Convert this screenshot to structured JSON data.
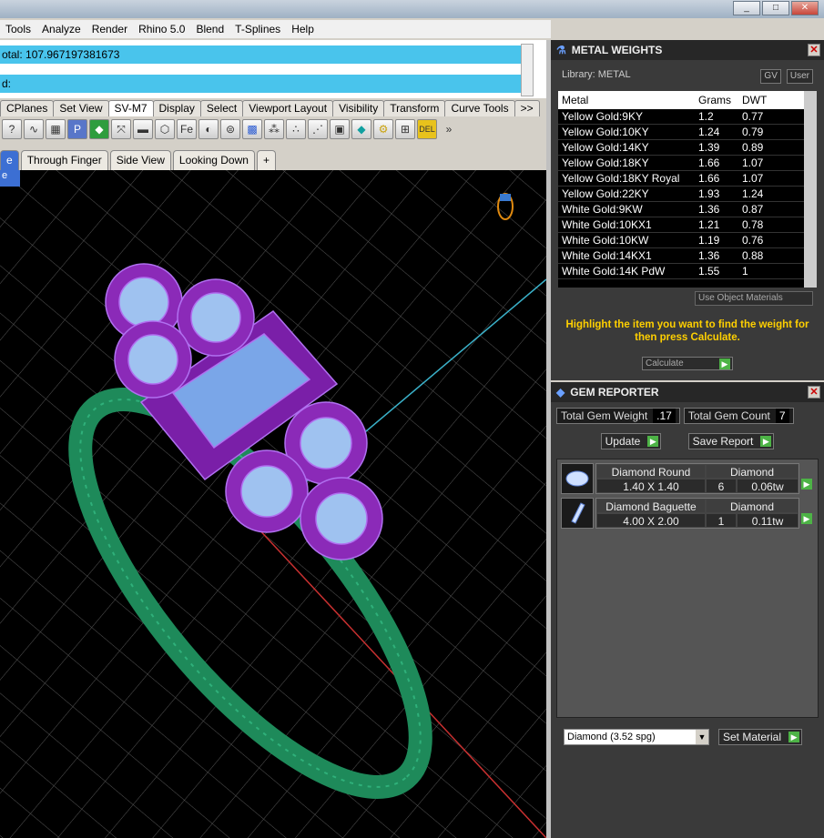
{
  "window_buttons": [
    "_",
    "□",
    "✕"
  ],
  "menu": [
    "Tools",
    "Analyze",
    "Render",
    "Rhino 5.0",
    "Blend",
    "T-Splines",
    "Help"
  ],
  "command": {
    "line1": "otal: 107.967197381673",
    "line2": "d:"
  },
  "toolbar_tabs": [
    "CPlanes",
    "Set View",
    "SV-M7",
    "Display",
    "Select",
    "Viewport Layout",
    "Visibility",
    "Transform",
    "Curve Tools",
    ">>"
  ],
  "viewport_tabs": [
    "e",
    "Through Finger",
    "Side View",
    "Looking Down",
    "+"
  ],
  "viewport_label": "e",
  "metal_weights": {
    "title": "METAL WEIGHTS",
    "library": "Library: METAL",
    "gv": "GV",
    "user": "User",
    "headers": [
      "Metal",
      "Grams",
      "DWT"
    ],
    "rows": [
      [
        "Yellow Gold:9KY",
        "1.2",
        "0.77"
      ],
      [
        "Yellow Gold:10KY",
        "1.24",
        "0.79"
      ],
      [
        "Yellow Gold:14KY",
        "1.39",
        "0.89"
      ],
      [
        "Yellow Gold:18KY",
        "1.66",
        "1.07"
      ],
      [
        "Yellow Gold:18KY Royal",
        "1.66",
        "1.07"
      ],
      [
        "Yellow Gold:22KY",
        "1.93",
        "1.24"
      ],
      [
        "White Gold:9KW",
        "1.36",
        "0.87"
      ],
      [
        "White Gold:10KX1",
        "1.21",
        "0.78"
      ],
      [
        "White Gold:10KW",
        "1.19",
        "0.76"
      ],
      [
        "White Gold:14KX1",
        "1.36",
        "0.88"
      ],
      [
        "White Gold:14K PdW",
        "1.55",
        "1"
      ]
    ],
    "use_object": "Use Object Materials",
    "hint": "Highlight the item you want to find the weight for then press Calculate.",
    "calculate": "Calculate"
  },
  "gem_reporter": {
    "title": "GEM REPORTER",
    "total_weight_label": "Total Gem Weight",
    "total_weight": ".17",
    "total_count_label": "Total Gem Count",
    "total_count": "7",
    "update": "Update",
    "save_report": "Save Report",
    "items": [
      {
        "name": "Diamond Round",
        "material": "Diamond",
        "size": "1.40 X 1.40",
        "count": "6",
        "weight": "0.06tw"
      },
      {
        "name": "Diamond Baguette",
        "material": "Diamond",
        "size": "4.00 X 2.00",
        "count": "1",
        "weight": "0.11tw"
      }
    ],
    "material_select": "Diamond     (3.52 spg)",
    "set_material": "Set Material"
  }
}
